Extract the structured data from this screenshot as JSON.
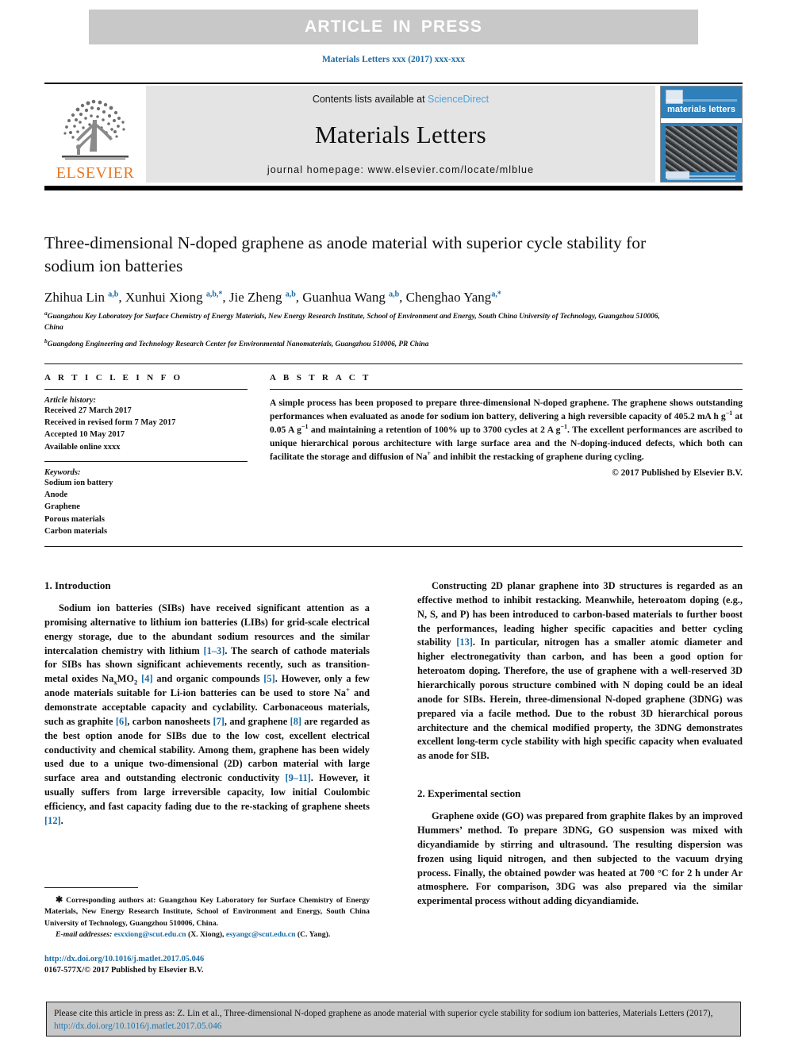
{
  "banner": {
    "text": "ARTICLE IN PRESS"
  },
  "journal_ref": "Materials Letters xxx (2017) xxx-xxx",
  "masthead": {
    "contents_prefix": "Contents lists available at ",
    "sciencedirect": "ScienceDirect",
    "journal_title": "Materials Letters",
    "homepage": "journal homepage: www.elsevier.com/locate/mlblue",
    "publisher": "ELSEVIER",
    "cover_title": "materials letters"
  },
  "article": {
    "title": "Three-dimensional N-doped graphene as anode material with superior cycle stability for sodium ion batteries",
    "authors_html": "Zhihua Lin <sup>a,b</sup>, Xunhui Xiong <sup>a,b,</sup><sup>*</sup>, Jie Zheng <sup>a,b</sup>, Guanhua Wang <sup>a,b</sup>, Chenghao Yang<sup>a,</sup><sup>*</sup>",
    "affiliation_a": "Guangzhou Key Laboratory for Surface Chemistry of Energy Materials, New Energy Research Institute, School of Environment and Energy, South China University of Technology, Guangzhou 510006, China",
    "affiliation_b": "Guangdong Engineering and Technology Research Center for Environmental Nanomaterials, Guangzhou 510006, PR China"
  },
  "info": {
    "heading": "A R T I C L E    I N F O",
    "history_label": "Article history:",
    "history": [
      "Received 27 March 2017",
      "Received in revised form 7 May 2017",
      "Accepted 10 May 2017",
      "Available online xxxx"
    ],
    "keywords_label": "Keywords:",
    "keywords": [
      "Sodium ion battery",
      "Anode",
      "Graphene",
      "Porous materials",
      "Carbon materials"
    ]
  },
  "abstract": {
    "heading": "A B S T R A C T",
    "body_html": "A simple process has been proposed to prepare three-dimensional N-doped graphene. The graphene shows outstanding performances when evaluated as anode for sodium ion battery, delivering a high reversible capacity of 405.2 mA h g<sup>&minus;1</sup> at 0.05 A g<sup>&minus;1</sup> and maintaining a retention of 100% up to 3700 cycles at 2 A g<sup>&minus;1</sup>. The excellent performances are ascribed to unique hierarchical porous architecture with large surface area and the N-doping-induced defects, which both can facilitate the storage and diffusion of Na<sup>+</sup> and inhibit the restacking of graphene during cycling.",
    "copyright": "© 2017 Published by Elsevier B.V."
  },
  "sections": {
    "introduction_heading": "1. Introduction",
    "introduction_html": "Sodium ion batteries (SIBs) have received significant attention as a promising alternative to lithium ion batteries (LIBs) for grid-scale electrical energy storage, due to the abundant sodium resources and the similar intercalation chemistry with lithium <span class=\"ref\">[1&ndash;3]</span>. The search of cathode materials for SIBs has shown significant achievements recently, such as transition-metal oxides Na<sub>x</sub>MO<sub>2</sub> <span class=\"ref\">[4]</span> and organic compounds <span class=\"ref\">[5]</span>. However, only a few anode materials suitable for Li-ion batteries can be used to store Na<sup>+</sup> and demonstrate acceptable capacity and cyclability. Carbonaceous materials, such as graphite <span class=\"ref\">[6]</span>, carbon nanosheets <span class=\"ref\">[7]</span>, and graphene <span class=\"ref\">[8]</span> are regarded as the best option anode for SIBs due to the low cost, excellent electrical conductivity and chemical stability. Among them, graphene has been widely used due to a unique two-dimensional (2D) carbon material with large surface area and outstanding electronic conductivity <span class=\"ref\">[9&ndash;11]</span>. However, it usually suffers from large irreversible capacity, low initial Coulombic efficiency, and fast capacity fading due to the re-stacking of graphene sheets <span class=\"ref\">[12]</span>.",
    "intro_cont_html": "Constructing 2D planar graphene into 3D structures is regarded as an effective method to inhibit restacking. Meanwhile, heteroatom doping (e.g., N, S, and P) has been introduced to carbon-based materials to further boost the performances, leading higher specific capacities and better cycling stability <span class=\"ref\">[13]</span>. In particular, nitrogen has a smaller atomic diameter and higher electronegativity than carbon, and has been a good option for heteroatom doping. Therefore, the use of graphene with a well-reserved 3D hierarchically porous structure combined with N doping could be an ideal anode for SIBs. Herein, three-dimensional N-doped graphene (3DNG) was prepared via a facile method. Due to the robust 3D hierarchical porous architecture and the chemical modified property, the 3DNG demonstrates excellent long-term cycle stability with high specific capacity when evaluated as anode for SIB.",
    "experimental_heading": "2. Experimental section",
    "experimental_html": "Graphene oxide (GO) was prepared from graphite flakes by an improved Hummers&rsquo; method. To prepare 3DNG, GO suspension was mixed with dicyandiamide by stirring and ultrasound. The resulting dispersion was frozen using liquid nitrogen, and then subjected to the vacuum drying process. Finally, the obtained powder was heated at 700 &deg;C for 2 h under Ar atmosphere. For comparison, 3DG was also prepared via the similar experimental process without adding dicyandiamide."
  },
  "footnote": {
    "corresponding_html": "<span style=\"font-size:11px;\">&#10033;</span> Corresponding authors at: Guangzhou Key Laboratory for Surface Chemistry of Energy Materials, New Energy Research Institute, School of Environment and Energy, South China University of Technology, Guangzhou 510006, China.",
    "email_html": "<span class=\"em\">E-mail addresses:</span> <span class=\"fn-link\">esxxiong@scut.edu.cn</span> (X. Xiong), <span class=\"fn-link\">esyangc@scut.edu.cn</span> (C. Yang).",
    "doi": "http://dx.doi.org/10.1016/j.matlet.2017.05.046",
    "issn": "0167-577X/© 2017 Published by Elsevier B.V."
  },
  "cite_box": {
    "text_html": "Please cite this article in press as: Z. Lin et al., Three-dimensional N-doped graphene as anode material with superior cycle stability for sodium ion batteries, Materials Letters (2017), <span class=\"fn-link\">http://dx.doi.org/10.1016/j.matlet.2017.05.046</span>"
  },
  "colors": {
    "link_blue": "#1a6ba5",
    "sciencedirect_blue": "#4ba3dd",
    "elsevier_orange": "#E87722",
    "banner_gray": "#c8c8c8",
    "masthead_gray": "#e4e4e4",
    "cover_blue": "#2f7fba"
  }
}
